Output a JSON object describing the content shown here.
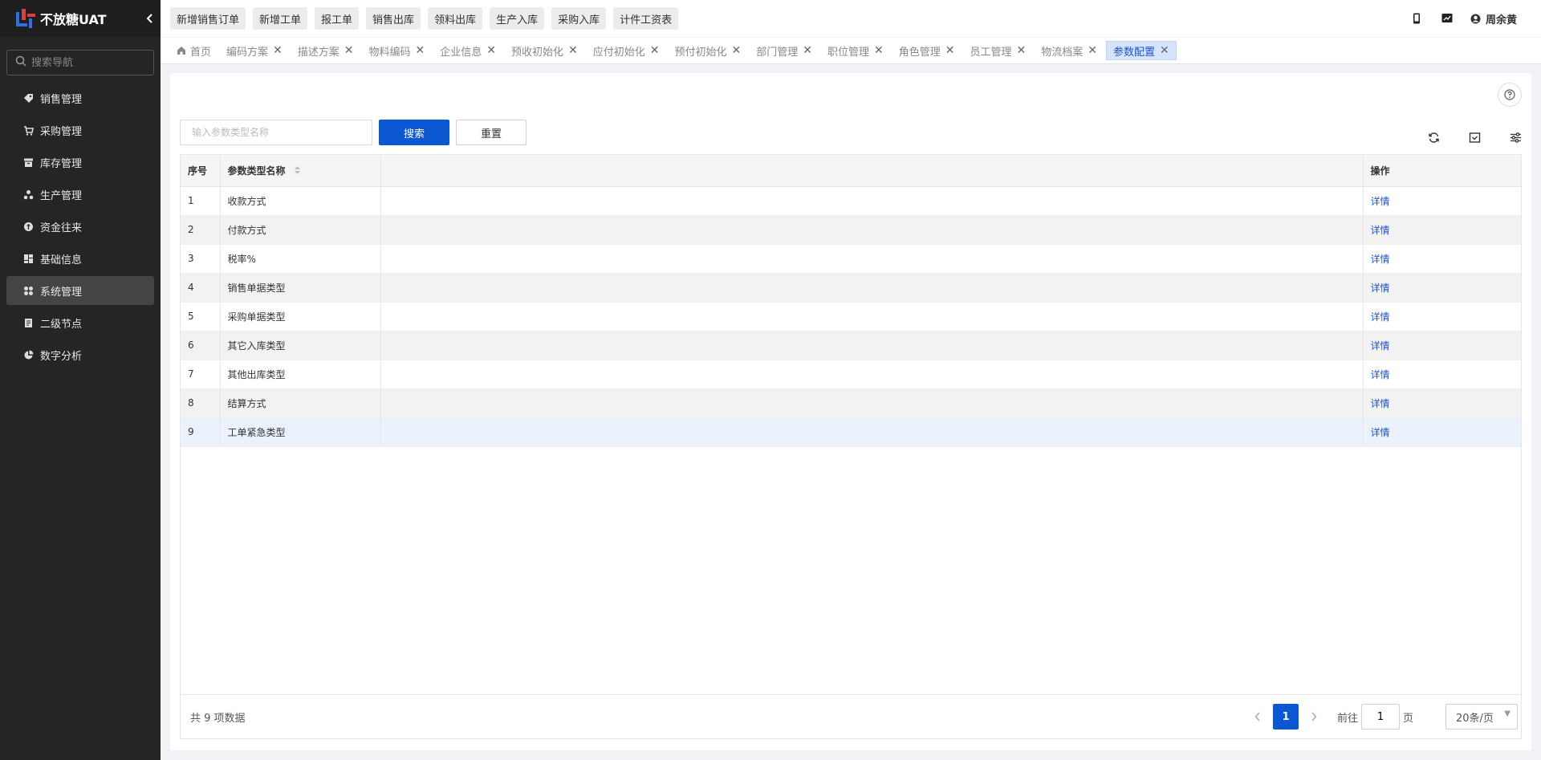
{
  "brand": {
    "title": "不放糖UAT"
  },
  "nav_search": {
    "placeholder": "搜索导航"
  },
  "menu": [
    {
      "label": "销售管理",
      "icon": "tag-icon"
    },
    {
      "label": "采购管理",
      "icon": "cart-icon"
    },
    {
      "label": "库存管理",
      "icon": "archive-icon"
    },
    {
      "label": "生产管理",
      "icon": "cluster-icon"
    },
    {
      "label": "资金往来",
      "icon": "coin-icon"
    },
    {
      "label": "基础信息",
      "icon": "dashboard-icon"
    },
    {
      "label": "系统管理",
      "icon": "apps-icon",
      "active": true
    },
    {
      "label": "二级节点",
      "icon": "document-icon"
    },
    {
      "label": "数字分析",
      "icon": "pie-chart-icon"
    }
  ],
  "quick_buttons": [
    "新增销售订单",
    "新增工单",
    "报工单",
    "销售出库",
    "领料出库",
    "生产入库",
    "采购入库",
    "计件工资表"
  ],
  "user": {
    "name": "周余黄"
  },
  "tabs": [
    {
      "label": "首页",
      "closable": false
    },
    {
      "label": "编码方案",
      "closable": true
    },
    {
      "label": "描述方案",
      "closable": true
    },
    {
      "label": "物料编码",
      "closable": true
    },
    {
      "label": "企业信息",
      "closable": true
    },
    {
      "label": "预收初始化",
      "closable": true
    },
    {
      "label": "应付初始化",
      "closable": true
    },
    {
      "label": "预付初始化",
      "closable": true
    },
    {
      "label": "部门管理",
      "closable": true
    },
    {
      "label": "职位管理",
      "closable": true
    },
    {
      "label": "角色管理",
      "closable": true
    },
    {
      "label": "员工管理",
      "closable": true
    },
    {
      "label": "物流档案",
      "closable": true
    },
    {
      "label": "参数配置",
      "closable": true,
      "active": true
    }
  ],
  "search": {
    "placeholder": "输入参数类型名称",
    "search_label": "搜索",
    "reset_label": "重置"
  },
  "table": {
    "headers": {
      "index": "序号",
      "name": "参数类型名称",
      "blank": "",
      "action": "操作"
    },
    "rows": [
      {
        "index": "1",
        "name": "收款方式",
        "action": "详情"
      },
      {
        "index": "2",
        "name": "付款方式",
        "action": "详情"
      },
      {
        "index": "3",
        "name": "税率%",
        "action": "详情"
      },
      {
        "index": "4",
        "name": "销售单据类型",
        "action": "详情"
      },
      {
        "index": "5",
        "name": "采购单据类型",
        "action": "详情"
      },
      {
        "index": "6",
        "name": "其它入库类型",
        "action": "详情"
      },
      {
        "index": "7",
        "name": "其他出库类型",
        "action": "详情"
      },
      {
        "index": "8",
        "name": "结算方式",
        "action": "详情"
      },
      {
        "index": "9",
        "name": "工单紧急类型",
        "action": "详情",
        "selected": true
      }
    ]
  },
  "pagination": {
    "total_text": "共 9 项数据",
    "current_page": "1",
    "goto_label": "前往",
    "goto_value": "1",
    "page_unit": "页",
    "page_size": "20条/页"
  },
  "colors": {
    "primary": "#0c58d2",
    "sidebar_bg": "#252525",
    "link": "#1b56c9",
    "active_tab_bg": "#d6e4fb"
  }
}
